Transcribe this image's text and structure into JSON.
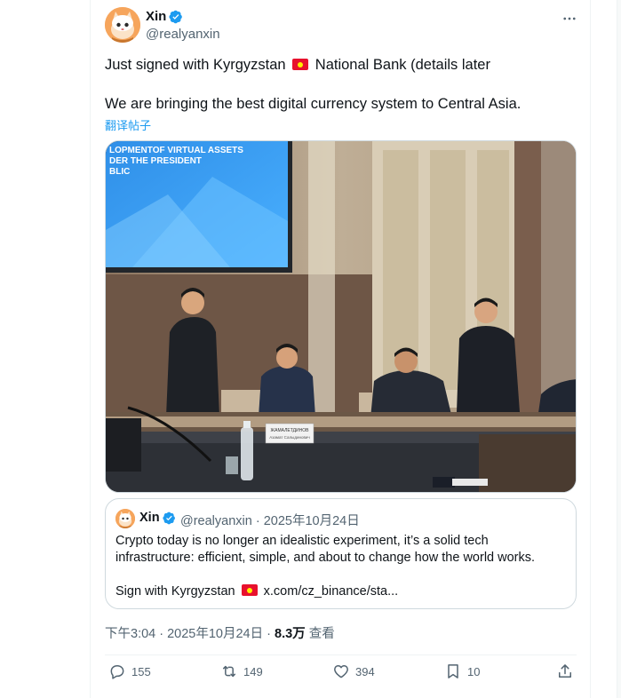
{
  "tweet": {
    "author": {
      "display_name": "Xin",
      "handle": "@realyanxin",
      "verified": true,
      "avatar_icon": "cartoon-avatar"
    },
    "text_line1_before_flag": "Just signed with Kyrgyzstan",
    "text_line1_after_flag": "National Bank (details later",
    "text_line2": "We are bringing the best digital currency system to Central Asia.",
    "translate_label": "翻译帖子",
    "flag_icon": "kyrgyzstan-flag",
    "media": {
      "screen_text_line1": "LOPMENTOF VIRTUAL ASSETS",
      "screen_text_line2": "DER THE PRESIDENT",
      "screen_text_line3": "BLIC",
      "nameplate_line1": "ЖАМАЛЕТДИНОВ",
      "nameplate_line2": "Азамат Салыдинович"
    },
    "timestamp": "下午3:04 · 2025年10月24日",
    "views_count": "8.3万",
    "views_label": "查看",
    "actions": {
      "replies": "155",
      "reposts": "149",
      "likes": "394",
      "bookmarks": "10"
    }
  },
  "quoted_tweet": {
    "display_name": "Xin",
    "handle": "@realyanxin",
    "date": "2025年10月24日",
    "line1": "Crypto today is no longer an idealistic experiment, it’s a solid tech",
    "line2": "infrastructure: efficient, simple, and about to change how the world works.",
    "line3_before_flag": "Sign with Kyrgyzstan",
    "line3_link": "x.com/cz_binance/sta..."
  },
  "colors": {
    "accent": "#1d9bf0",
    "secondary_text": "#536471",
    "border": "#cfd9de",
    "flag_red": "#e8112d"
  }
}
